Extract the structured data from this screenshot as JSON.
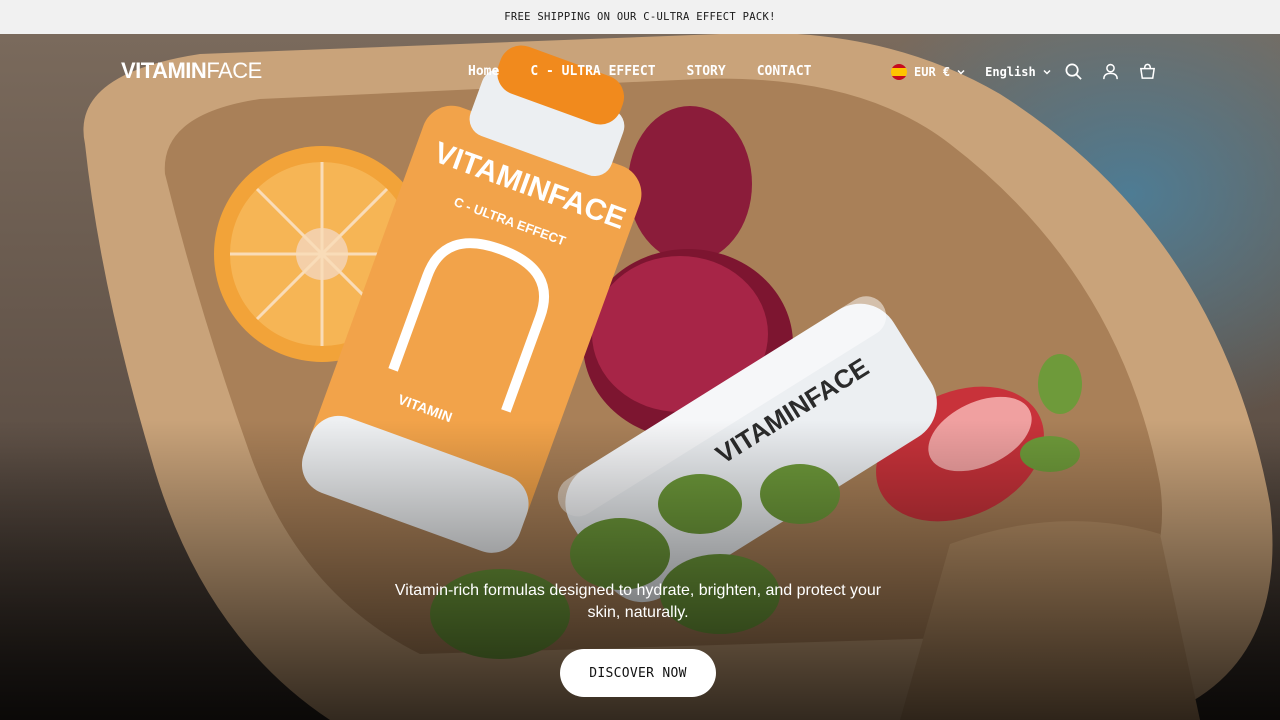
{
  "announcement": {
    "text": "FREE SHIPPING ON OUR C-ULTRA EFFECT PACK!"
  },
  "header": {
    "logo_bold": "VITAMIN",
    "logo_light": "FACE",
    "nav": [
      {
        "label": "Home"
      },
      {
        "label": "C - ULTRA EFFECT"
      },
      {
        "label": "STORY"
      },
      {
        "label": "CONTACT"
      }
    ],
    "currency": {
      "value": "EUR €",
      "flag": "spain-flag-icon"
    },
    "language": {
      "value": "English"
    },
    "icons": [
      "search-icon",
      "account-icon",
      "cart-icon"
    ]
  },
  "hero": {
    "image_bottle_brand": "VITAMINFACE",
    "image_bottle_line": "C - ULTRA EFFECT",
    "image_bottle_label": "VITAMIN",
    "tagline": "Vitamin-rich formulas designed to hydrate, brighten, and protect your skin, naturally.",
    "cta_label": "DISCOVER NOW"
  },
  "colors": {
    "announcement_bg": "#f1f1f1",
    "accent_orange": "#f2a34a",
    "cta_bg": "#ffffff"
  }
}
